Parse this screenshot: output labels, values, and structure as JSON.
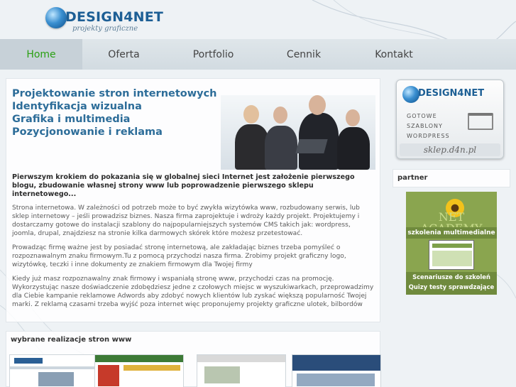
{
  "brand": {
    "name": "DESIGN4NET",
    "tagline": "projekty graficzne"
  },
  "nav": [
    {
      "label": "Home",
      "active": true
    },
    {
      "label": "Oferta",
      "active": false
    },
    {
      "label": "Portfolio",
      "active": false
    },
    {
      "label": "Cennik",
      "active": false
    },
    {
      "label": "Kontakt",
      "active": false
    }
  ],
  "main": {
    "services": [
      "Projektowanie stron internetowych",
      "Identyfikacja wizualna",
      "Grafika i multimedia",
      "Pozycjonowanie i reklama"
    ],
    "intro": "Pierwszym krokiem do pokazania się w globalnej sieci Internet jest założenie pierwszego blogu, zbudowanie własnej strony www lub poprowadzenie pierwszego sklepu internetowego...",
    "paragraphs": [
      "Strona internetowa. W zależności od potrzeb może to być zwykła wizytówka www, rozbudowany serwis, lub sklep internetowy – jeśli prowadzisz biznes. Nasza firma zaprojektuje i wdroży każdy projekt. Projektujemy i dostarczamy gotowe do instalacji szablony do najpopularniejszych systemów CMS takich jak: wordpress, joomla, drupal, znajdziesz na stronie kilka darmowych skórek które możesz przetestować.",
      "Prowadząc firmę ważne jest by posiadać stronę internetową, ale zakładając biznes trzeba pomyśleć o rozpoznawalnym znaku firmowym.Tu z pomocą przychodzi nasza firma. Zrobimy projekt graficzny logo, wizytówkę, teczki i  inne dokumenty ze znakiem firmowym dla Twojej firmy",
      "Kiedy już masz rozpoznawalny znak firmowy i wspaniałą stronę www, przychodzi czas na promocję. Wykorzystując nasze doświadczenie zdobędziesz jedne z czołowych miejsc w wyszukiwarkach, przeprowadzimy dla Ciebie kampanie reklamowe Adwords aby zdobyć nowych klientów lub zyskać większą popularność Twojej marki. Z reklamą czasami trzeba wyjść poza internet więc proponujemy projekty graficzne ulotek, bilbordów"
    ]
  },
  "works": {
    "title": "wybrane realizacje stron www"
  },
  "sidebar": {
    "shop_brand": "DESIGN4NET",
    "shop_lines": [
      "GOTOWE",
      "SZABLONY",
      "WORDPRESS"
    ],
    "shop_url": "sklep.d4n.pl",
    "partner_label": "partner",
    "academy": {
      "name": "NET ACADEMY",
      "band": "szkolenia multimedialne",
      "line1": "Scenariusze do szkoleń",
      "line2": "Quizy testy sprawdzające"
    }
  },
  "colors": {
    "accent_green": "#2aa012",
    "heading_blue": "#2d6d99",
    "logo_blue": "#1d5f95"
  }
}
